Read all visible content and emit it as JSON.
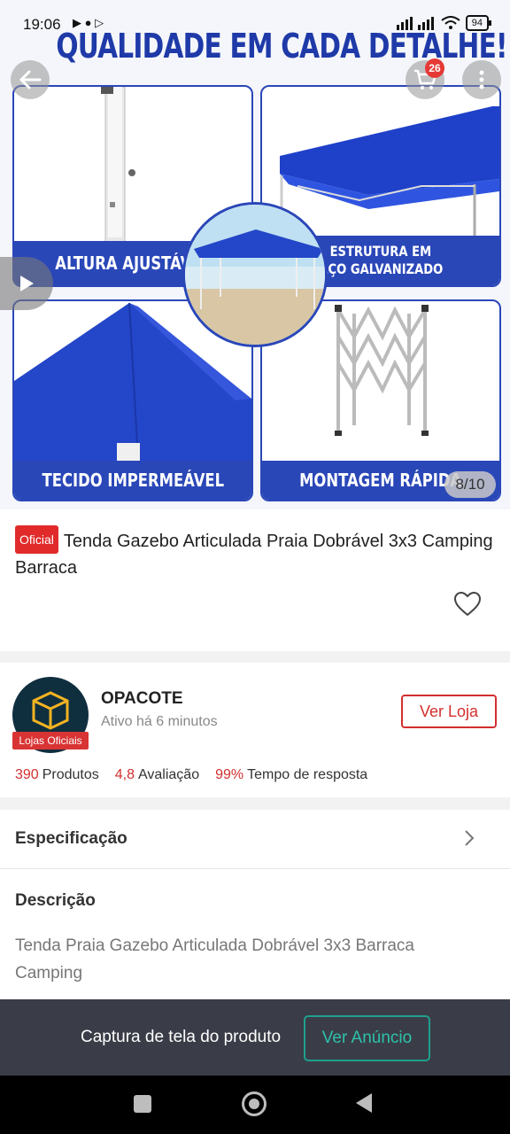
{
  "status_bar": {
    "time": "19:06",
    "battery": "94"
  },
  "hero": {
    "headline": "QUALIDADE EM CADA DETALHE!",
    "cart_count": "26",
    "panels": [
      {
        "label": "ALTURA AJUSTÁVEL"
      },
      {
        "label_line1": "ESTRUTURA EM",
        "label_line2": "AÇO GALVANIZADO"
      },
      {
        "label": "TECIDO IMPERMEÁVEL"
      },
      {
        "label": "MONTAGEM RÁPIDA"
      }
    ],
    "image_counter": "8/10",
    "icons": {
      "back": "back-arrow-icon",
      "cart": "cart-icon",
      "more": "more-vertical-icon",
      "play": "play-icon"
    },
    "colors": {
      "brand_blue": "#2a47b8"
    }
  },
  "product": {
    "badge": "Oficial",
    "title": "Tenda Gazebo Articulada Praia Dobrável 3x3 Camping Barraca",
    "favorite_icon": "heart-icon"
  },
  "store": {
    "name": "OPACOTE",
    "active": "Ativo há 6 minutos",
    "tag": "Lojas Oficiais",
    "view_button": "Ver Loja",
    "stats": [
      {
        "value": "390",
        "label": "Produtos"
      },
      {
        "value": "4,8",
        "label": "Avaliação"
      },
      {
        "value": "99%",
        "label": "Tempo de resposta"
      }
    ]
  },
  "details": {
    "spec_label": "Especificação",
    "desc_title": "Descrição",
    "desc_text": "Tenda Praia Gazebo Articulada Dobrável 3x3 Barraca Camping"
  },
  "capture_bar": {
    "text": "Captura de tela do produto",
    "button": "Ver Anúncio"
  },
  "colors": {
    "accent_red": "#d32f2f",
    "teal": "#1fa08e",
    "dark_bar": "#3a3d47"
  }
}
